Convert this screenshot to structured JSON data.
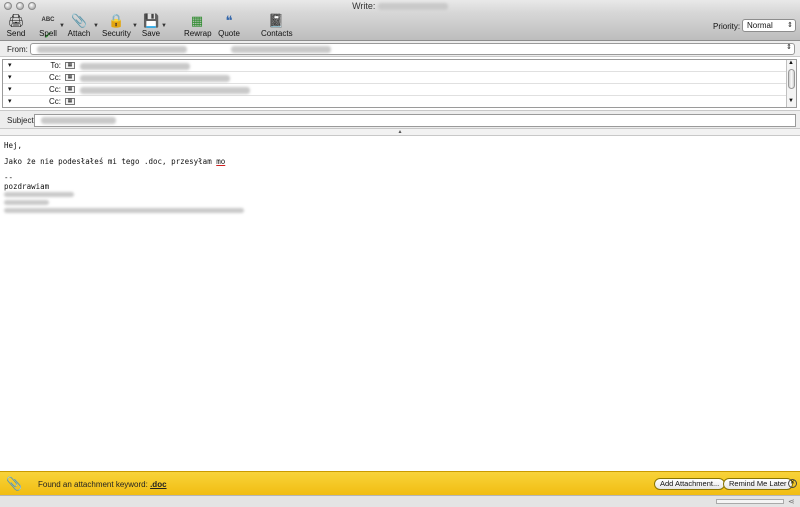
{
  "window": {
    "title": "Write:"
  },
  "toolbar": {
    "send": "Send",
    "spell": "Spell",
    "spell_abc": "ABC",
    "attach": "Attach",
    "security": "Security",
    "save": "Save",
    "rewrap": "Rewrap",
    "quote": "Quote",
    "contacts": "Contacts",
    "priority_label": "Priority:",
    "priority_value": "Normal"
  },
  "header": {
    "from_label": "From:",
    "recipients": [
      {
        "kind": "To:"
      },
      {
        "kind": "Cc:"
      },
      {
        "kind": "Cc:"
      },
      {
        "kind": "Cc:"
      }
    ],
    "subject_label": "Subject:"
  },
  "body": {
    "line1": "Hej,",
    "line2_prefix": "Jako że nie podesłałeś mi tego .doc, przesyłam ",
    "line2_misspelled": "mo",
    "sig_dash": "--",
    "sig_greeting": "pozdrawiam"
  },
  "notification": {
    "message": "Found an attachment keyword:",
    "keyword": ".doc",
    "add_button": "Add Attachment...",
    "remind_button": "Remind Me Later"
  }
}
